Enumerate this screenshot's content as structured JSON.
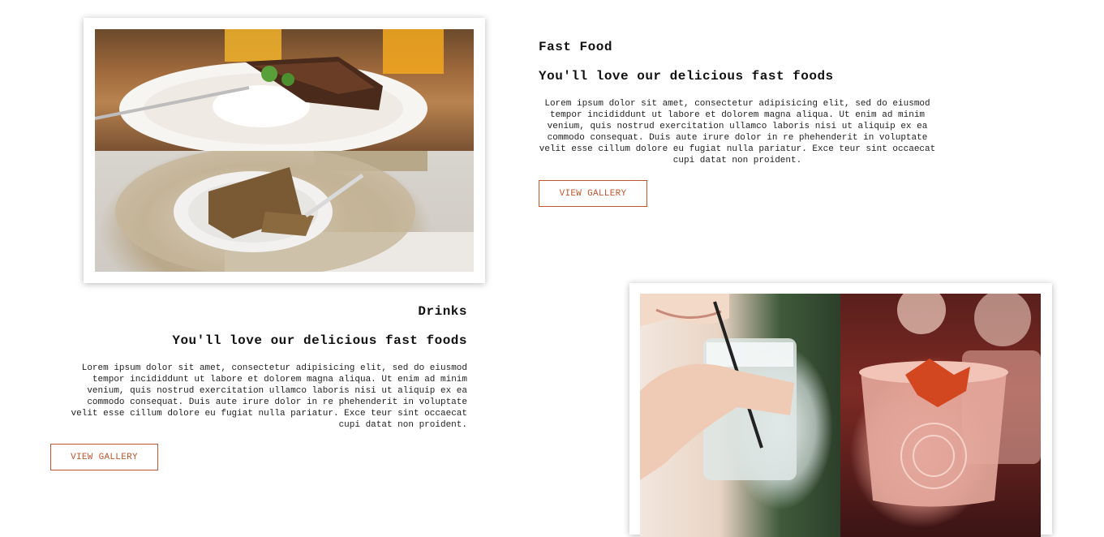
{
  "fast_food": {
    "title": "Fast Food",
    "subtitle": "You'll love our delicious fast foods",
    "body": "Lorem ipsum dolor sit amet, consectetur adipisicing elit, sed do eiusmod tempor incididdunt ut labore et dolorem magna aliqua. Ut enim ad minim venium, quis nostrud exercitation ullamco laboris nisi ut aliquip ex ea commodo consequat. Duis aute irure dolor in re phehenderit in voluptate velit esse cillum dolore eu fugiat nulla pariatur. Exce teur sint occaecat cupi datat non proident.",
    "button_label": "VIEW GALLERY"
  },
  "drinks": {
    "title": "Drinks",
    "subtitle": "You'll love our delicious fast foods",
    "body": "Lorem ipsum dolor sit amet, consectetur adipisicing elit, sed do eiusmod tempor incididdunt ut labore et dolorem magna aliqua. Ut enim ad minim venium, quis nostrud exercitation ullamco laboris nisi ut aliquip ex ea commodo consequat. Duis aute irure dolor in re phehenderit in voluptate velit esse cillum dolore eu fugiat nulla pariatur. Exce teur sint occaecat cupi datat non proident.",
    "button_label": "VIEW GALLERY"
  },
  "colors": {
    "accent": "#c0562e",
    "text": "#111111",
    "background": "#ffffff"
  }
}
